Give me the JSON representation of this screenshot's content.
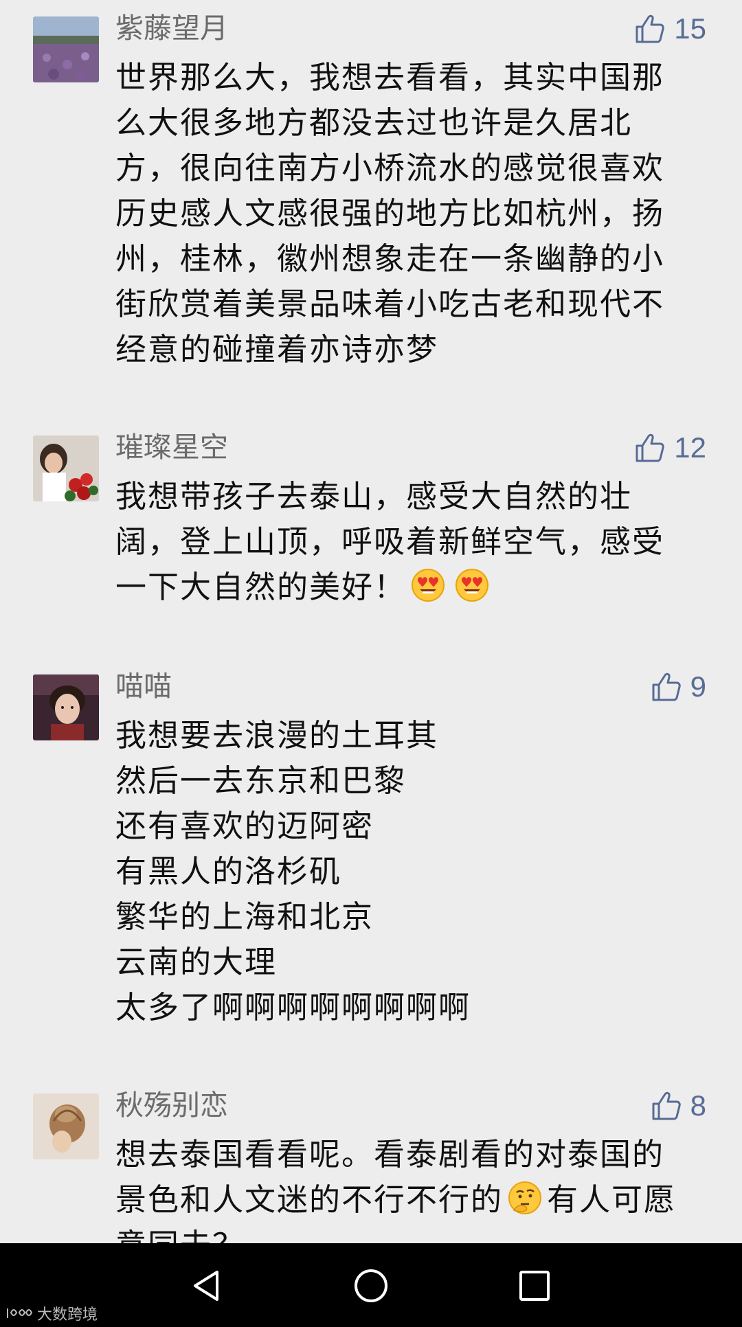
{
  "comments": [
    {
      "username": "紫藤望月",
      "likes": "15",
      "lines": [
        "世界那么大，我想去看看，其实中国那",
        "么大很多地方都没去过也许是久居北",
        "方，很向往南方小桥流水的感觉很喜欢",
        "历史感人文感很强的地方比如杭州，扬",
        "州，桂林，徽州想象走在一条幽静的小",
        "街欣赏着美景品味着小吃古老和现代不",
        "经意的碰撞着亦诗亦梦"
      ]
    },
    {
      "username": "璀璨星空",
      "likes": "12",
      "lines": [
        "我想带孩子去泰山，感受大自然的壮",
        "阔，登上山顶，呼吸着新鲜空气，感受",
        "一下大自然的美好！"
      ],
      "emoji": "heart-eyes-emoji"
    },
    {
      "username": "喵喵",
      "likes": "9",
      "lines": [
        "我想要去浪漫的土耳其",
        "然后一去东京和巴黎",
        "还有喜欢的迈阿密",
        "有黑人的洛杉矶",
        "繁华的上海和北京",
        "云南的大理",
        "太多了啊啊啊啊啊啊啊啊"
      ]
    },
    {
      "username": "秋殇别恋",
      "likes": "8",
      "lines": [
        "想去泰国看看呢。看泰剧看的对泰国的",
        "景色和人文迷的不行不行的",
        "意同去？"
      ],
      "line2_suffix": "有人可愿",
      "emoji": "thinking-emoji"
    }
  ],
  "icons": {
    "like": "thumbs-up-icon",
    "back": "back-triangle-icon",
    "home": "home-circle-icon",
    "recents": "recents-square-icon"
  },
  "watermark": "大数跨境",
  "colors": {
    "background": "#ededed",
    "username": "#6b6b6b",
    "like": "#576b95",
    "text": "#111111",
    "navbar": "#000000"
  }
}
